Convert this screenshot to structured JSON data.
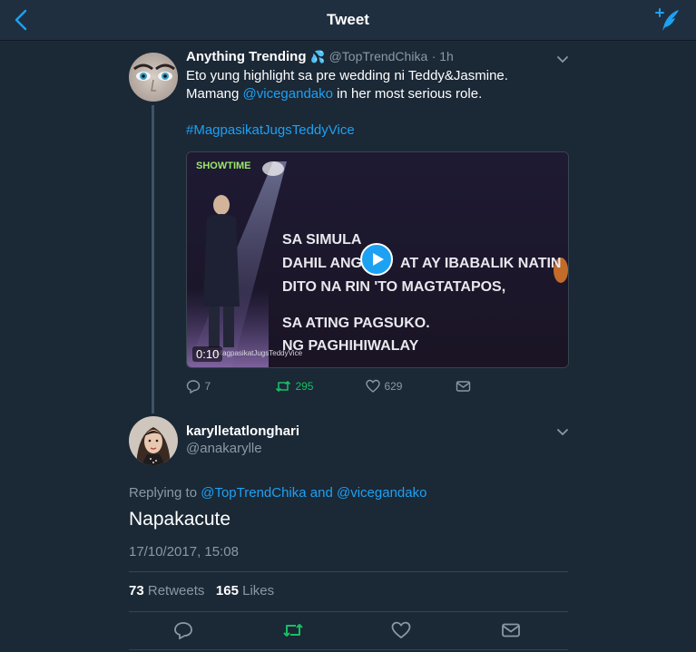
{
  "header": {
    "title": "Tweet",
    "back_icon": "chevron-left-icon",
    "compose_icon": "compose-tweet-icon",
    "accent": "#1da1f2"
  },
  "original_tweet": {
    "display_name": "Anything Trending",
    "badge_emoji": "💦",
    "handle": "@TopTrendChika",
    "time": "· 1h",
    "line1": "Eto yung highlight sa pre wedding ni Teddy&Jasmine.",
    "line2_prefix": "Mamang ",
    "mention": "@vicegandako",
    "line2_suffix": " in her most serious role.",
    "hashtag": "#MagpasikatJugsTeddyVice",
    "video": {
      "duration": "0:10",
      "logo": "SHOWTIME",
      "caption_lines": [
        "SA SIMULA",
        "DAHIL ANG",
        "AT AY IBABALIK NATIN",
        "DITO NA RIN 'TO MAGTATAPOS,",
        "SA ATING PAGSUKO.",
        "NG PAGHIHIWALAY"
      ],
      "watermark": "#MagpasikatJugsTeddyVice"
    },
    "replies": "7",
    "retweets": "295",
    "likes": "629"
  },
  "reply_tweet": {
    "display_name": "karylletatlonghari",
    "handle": "@anakarylle",
    "replying_label": "Replying to ",
    "replying_to_1": "@TopTrendChika",
    "replying_and": " and ",
    "replying_to_2": "@vicegandako",
    "text": "Napakacute",
    "timestamp": "17/10/2017, 15:08",
    "retweets_count": "73",
    "retweets_label": "Retweets",
    "likes_count": "165",
    "likes_label": "Likes"
  },
  "colors": {
    "background": "#1b2836",
    "retweet_green": "#17bf63",
    "muted": "#8899a6"
  }
}
